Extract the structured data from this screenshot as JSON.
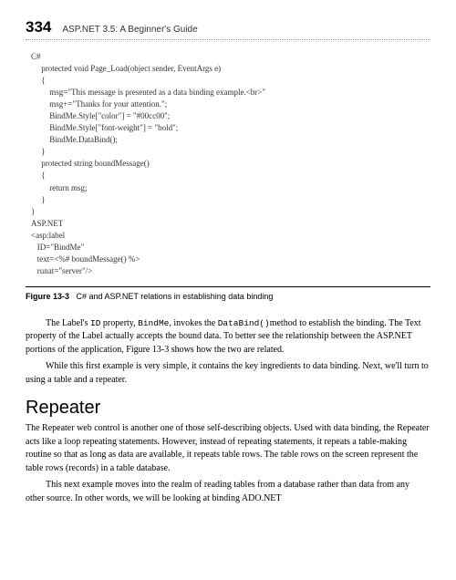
{
  "header": {
    "page_number": "334",
    "book_title": "ASP.NET 3.5: A Beginner's Guide"
  },
  "code": {
    "lang1": "C#",
    "line1": "     protected void Page_Load(object sender, EventArgs e)",
    "line2": "     {",
    "line3": "         msg=\"This message is presented as a data binding example.<br>\"",
    "line4": "         msg+=\"Thanks for your attention.\";",
    "line5": "         BindMe.Style[\"color\"] = \"#00cc00\";",
    "line6": "         BindMe.Style[\"font-weight\"] = \"bold\";",
    "line7": "         BindMe.DataBind();",
    "line8": "     }",
    "line9": "     protected string boundMessage()",
    "line10": "     {",
    "line11": "         return msg;",
    "line12": "     }",
    "line13": "}",
    "lang2": "ASP.NET",
    "line14": "<asp:label",
    "line15": "   ID=\"BindMe\"",
    "line16": "   text=<%# boundMessage() %>",
    "line17": "   runat=\"server\"/>"
  },
  "figure": {
    "label": "Figure 13-3",
    "caption": "C# and ASP.NET relations in establishing data binding"
  },
  "para1_a": "The Label's ",
  "para1_b": " property, ",
  "para1_c": ", invokes the ",
  "para1_d": "method to establish the binding. The Text property of the Label actually accepts the bound data. To better see the relationship between the ASP.NET portions of the application, Figure 13-3 shows how the two are related.",
  "inline_id": "ID",
  "inline_bindme": "BindMe",
  "inline_databind": "DataBind()",
  "para2": "While this first example is very simple, it contains the key ingredients to data binding. Next, we'll turn to using a table and a repeater.",
  "section": {
    "heading": "Repeater"
  },
  "para3": "The Repeater web control is another one of those self-describing objects. Used with data binding, the Repeater acts like a loop repeating statements. However, instead of repeating statements, it repeats a table-making routine so that as long as data are available, it repeats table rows. The table rows on the screen represent the table rows (records) in a table database.",
  "para4": "This next example moves into the realm of reading tables from a database rather than data from any other source. In other words, we will be looking at binding ADO.NET"
}
